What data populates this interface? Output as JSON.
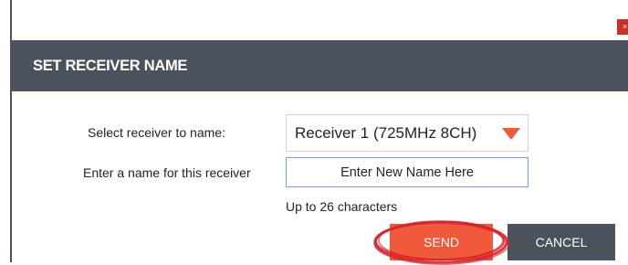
{
  "dialog": {
    "close_label": "×",
    "title": "SET RECEIVER NAME"
  },
  "form": {
    "select_label": "Select receiver to name:",
    "selected_receiver": "Receiver 1 (725MHz 8CH)",
    "name_label": "Enter a name for this receiver",
    "name_value": "Enter New Name Here",
    "hint": "Up to 26 characters"
  },
  "actions": {
    "send_label": "SEND",
    "cancel_label": "CANCEL"
  },
  "colors": {
    "header": "#4a535b",
    "accent": "#f05a3a",
    "close": "#c9302c",
    "annotation": "#d9232b"
  },
  "icons": {
    "close": "close-icon",
    "dropdown": "caret-down-icon"
  }
}
